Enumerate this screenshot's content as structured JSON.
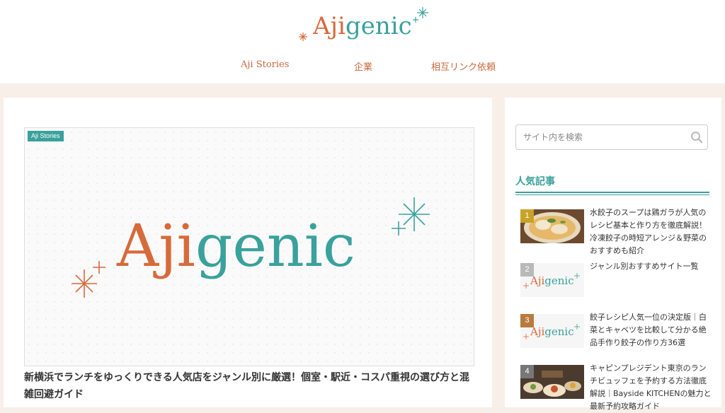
{
  "site": {
    "logo_text": "Ajigenic",
    "brand_colors": {
      "orange": "#d76a3b",
      "teal": "#3aa19c",
      "background": "#f8efe9"
    }
  },
  "nav": {
    "items": [
      {
        "label": "Aji Stories"
      },
      {
        "label": "企業"
      },
      {
        "label": "相互リンク依頼"
      }
    ]
  },
  "featured": {
    "category": "Aji Stories",
    "image_logo_text": "Ajigenic",
    "title": "新横浜でランチをゆっくりできる人気店をジャンル別に厳選！個室・駅近・コスパ重視の選び方と混雑回避ガイド"
  },
  "sidebar": {
    "search": {
      "placeholder": "サイト内を検索",
      "icon": "search-icon"
    },
    "popular_heading": "人気記事",
    "popular": [
      {
        "rank": "1",
        "rank_color": "#c9a227",
        "thumb": "dumpling-soup-photo",
        "title": "水餃子のスープは鶏ガラが人気のレシピ基本と作り方を徹底解説！冷凍餃子の時短アレンジ＆野菜のおすすめも紹介"
      },
      {
        "rank": "2",
        "rank_color": "#b9b9b9",
        "thumb": "ajigenic-logo-thumb",
        "title": "ジャンル別おすすめサイト一覧"
      },
      {
        "rank": "3",
        "rank_color": "#b87a3d",
        "thumb": "ajigenic-logo-thumb",
        "title": "餃子レシピ人気一位の決定版｜白菜とキャベツを比較して分かる絶品手作り餃子の作り方36選"
      },
      {
        "rank": "4",
        "rank_color": "#777777",
        "thumb": "buffet-photo",
        "title": "キャピンプレジデント東京のランチビュッフェを予約する方法徹底解説｜Bayside KITCHENの魅力と最新予約攻略ガイド"
      }
    ]
  }
}
